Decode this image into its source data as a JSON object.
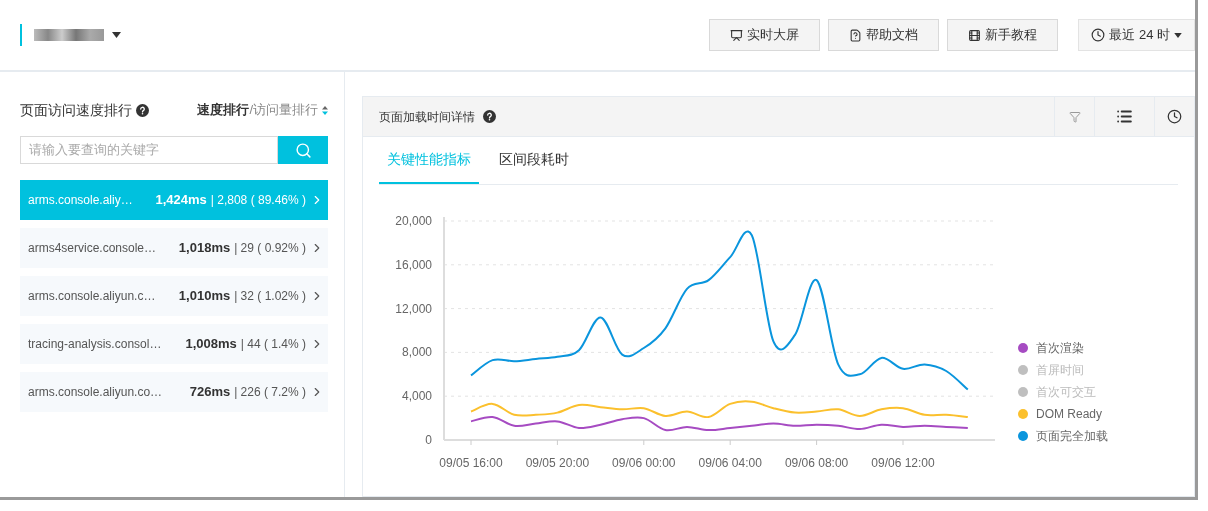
{
  "header": {
    "buttons": [
      {
        "kind": "screen",
        "label": "实时大屏"
      },
      {
        "kind": "doc",
        "label": "帮助文档"
      },
      {
        "kind": "guide",
        "label": "新手教程"
      }
    ],
    "time_range": {
      "label": "最近 24 时"
    }
  },
  "ranking": {
    "title": "页面访问速度排行",
    "sort": {
      "options": [
        {
          "label": "速度排行",
          "selected": true
        },
        {
          "label": "访问量排行",
          "selected": false
        }
      ],
      "separator": "/"
    },
    "search": {
      "placeholder": "请输入要查询的关键字"
    },
    "items": [
      {
        "name": "arms.console.aliy…",
        "time": "1,424ms",
        "detail": "| 2,808 ( 89.46% )",
        "selected": true
      },
      {
        "name": "arms4service.console…",
        "time": "1,018ms",
        "detail": "| 29 ( 0.92% )",
        "selected": false
      },
      {
        "name": "arms.console.aliyun.c…",
        "time": "1,010ms",
        "detail": "| 32 ( 1.02% )",
        "selected": false
      },
      {
        "name": "tracing-analysis.consol…",
        "time": "1,008ms",
        "detail": "| 44 ( 1.4% )",
        "selected": false
      },
      {
        "name": "arms.console.aliyun.co…",
        "time": "726ms",
        "detail": "| 226 ( 7.2% )",
        "selected": false
      }
    ]
  },
  "detail": {
    "title": "页面加载时间详情",
    "tabs": [
      {
        "label": "关键性能指标",
        "selected": true
      },
      {
        "label": "区间段耗时",
        "selected": false
      }
    ],
    "chart_data": {
      "type": "line",
      "categories": [
        "09/05 16:00",
        null,
        null,
        null,
        "09/05 20:00",
        null,
        null,
        null,
        "09/06 00:00",
        null,
        null,
        null,
        "09/06 04:00",
        null,
        null,
        null,
        "09/06 08:00",
        null,
        null,
        null,
        "09/06 12:00",
        null,
        null,
        null
      ],
      "yticks": [
        {
          "value": 0,
          "label": "0"
        },
        {
          "value": 4000,
          "label": "4,000"
        },
        {
          "value": 8000,
          "label": "8,000"
        },
        {
          "value": 12000,
          "label": "12,000"
        },
        {
          "value": 16000,
          "label": "16,000"
        },
        {
          "value": 20000,
          "label": "20,000"
        }
      ],
      "ylim": [
        0,
        20000
      ],
      "grid": true,
      "series": [
        {
          "name": "首次渲染",
          "color": "#a64bc2",
          "values": [
            1700,
            2100,
            1300,
            1500,
            1700,
            1100,
            1400,
            1900,
            2000,
            900,
            1200,
            900,
            1100,
            1300,
            1500,
            1300,
            1400,
            1300,
            1000,
            1400,
            1200,
            1300,
            1200,
            1100
          ]
        },
        {
          "name": "首屏时间",
          "color": "#bfbfbf",
          "values": [
            null,
            null,
            null,
            null,
            null,
            null,
            null,
            null,
            null,
            null,
            null,
            null,
            null,
            null,
            null,
            null,
            null,
            null,
            null,
            null,
            null,
            null,
            null,
            null
          ]
        },
        {
          "name": "首次可交互",
          "color": "#bfbfbf",
          "values": [
            null,
            null,
            null,
            null,
            null,
            null,
            null,
            null,
            null,
            null,
            null,
            null,
            null,
            null,
            null,
            null,
            null,
            null,
            null,
            null,
            null,
            null,
            null,
            null
          ]
        },
        {
          "name": "DOM Ready",
          "color": "#fbc02d",
          "values": [
            2600,
            3300,
            2300,
            2300,
            2500,
            3200,
            3000,
            2800,
            2900,
            2200,
            2600,
            2100,
            3300,
            3500,
            2900,
            2500,
            2600,
            2800,
            2200,
            2800,
            2900,
            2300,
            2300,
            2100
          ]
        },
        {
          "name": "页面完全加载",
          "color": "#0a95dd",
          "values": [
            5900,
            7300,
            7200,
            7400,
            7600,
            8200,
            11200,
            7800,
            8400,
            10200,
            13800,
            14600,
            16700,
            18700,
            9000,
            9600,
            14600,
            6900,
            6000,
            7500,
            6500,
            6900,
            6300,
            4600
          ]
        }
      ]
    }
  }
}
